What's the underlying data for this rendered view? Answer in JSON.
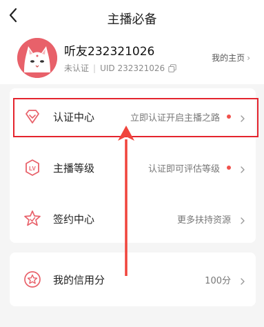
{
  "header": {
    "title": "主播必备",
    "back_icon": "chevron-left-icon"
  },
  "profile": {
    "username": "听友232321026",
    "verification_status": "未认证",
    "uid": "UID 232321026",
    "homepage_label": "我的主页",
    "avatar_icon": "cat-avatar-icon"
  },
  "menu": [
    {
      "label": "认证中心",
      "desc": "立即认证开启主播之路",
      "has_dot": true,
      "icon": "diamond-badge-icon"
    },
    {
      "label": "主播等级",
      "desc": "认证即可评估等级",
      "has_dot": true,
      "icon": "lv-badge-icon"
    },
    {
      "label": "签约中心",
      "desc": "更多扶持资源",
      "has_dot": false,
      "icon": "star-badge-icon"
    }
  ],
  "credit": {
    "label": "我的信用分",
    "value": "100分",
    "icon": "credit-star-icon"
  },
  "colors": {
    "accent": "#e8616a",
    "dot": "#f0514c",
    "annotation": "#e4232d"
  }
}
